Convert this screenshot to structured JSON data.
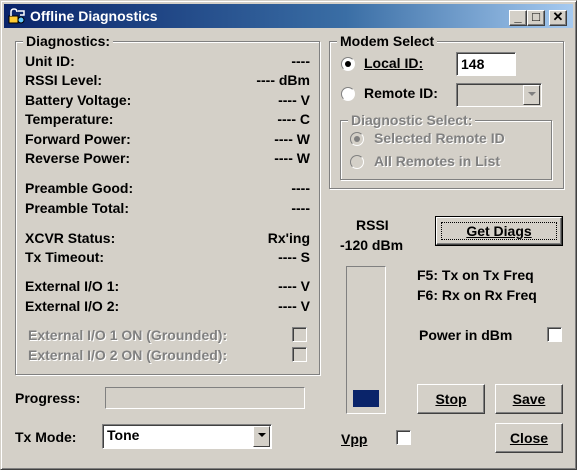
{
  "window": {
    "title": "Offline Diagnostics",
    "min_label": "_",
    "max_label": "□",
    "close_label": "✕"
  },
  "diagnostics": {
    "legend": "Diagnostics:",
    "rows": [
      {
        "label": "Unit ID:",
        "value": "----"
      },
      {
        "label": "RSSI Level:",
        "value": "---- dBm"
      },
      {
        "label": "Battery Voltage:",
        "value": "---- V"
      },
      {
        "label": "Temperature:",
        "value": "---- C"
      },
      {
        "label": "Forward Power:",
        "value": "---- W"
      },
      {
        "label": "Reverse Power:",
        "value": "---- W"
      },
      {
        "label": "Preamble Good:",
        "value": "----"
      },
      {
        "label": "Preamble Total:",
        "value": "----"
      },
      {
        "label": "XCVR Status:",
        "value": "Rx'ing"
      },
      {
        "label": "Tx Timeout:",
        "value": "---- S"
      },
      {
        "label": "External I/O 1:",
        "value": "---- V"
      },
      {
        "label": "External I/O 2:",
        "value": "---- V"
      }
    ],
    "io1_grounded_label": "External I/O 1 ON (Grounded):",
    "io2_grounded_label": "External I/O 2 ON (Grounded):"
  },
  "modem": {
    "legend": "Modem Select",
    "local_id_label": "Local ID:",
    "local_id_value": "148",
    "remote_id_label": "Remote ID:",
    "remote_id_value": "",
    "diag_select": {
      "legend": "Diagnostic Select:",
      "opt_selected": "Selected Remote ID",
      "opt_all": "All Remotes in List"
    }
  },
  "rssi": {
    "label": "RSSI",
    "value_text": "-120 dBm",
    "bar_fill_fraction": 0.13,
    "bar_color": "#0a246a"
  },
  "get_diags_label": "Get Diags",
  "hint_f5": "F5: Tx on Tx Freq",
  "hint_f6": "F6: Rx on Rx Freq",
  "power_in_dbm_label": "Power in dBm",
  "progress_label": "Progress:",
  "progress_fraction": 0,
  "stop_label": "Stop",
  "save_label": "Save",
  "tx_mode_label": "Tx Mode:",
  "tx_mode_value": "Tone",
  "vpp_label": "Vpp",
  "close_label": "Close"
}
